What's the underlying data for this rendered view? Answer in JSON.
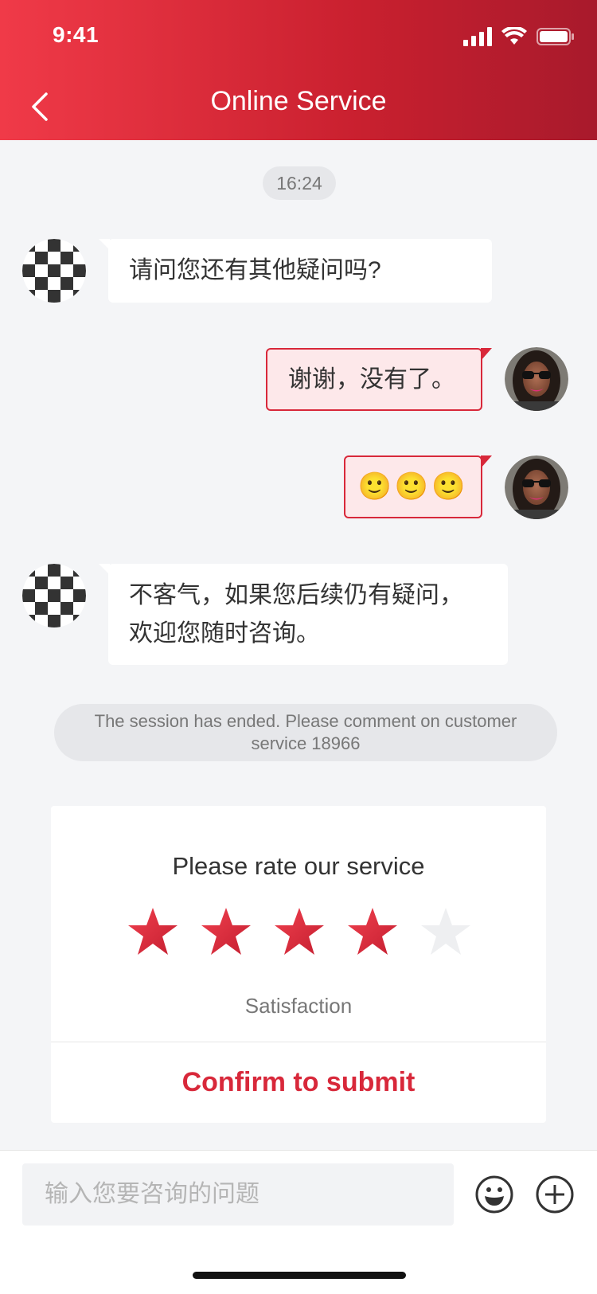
{
  "status_bar": {
    "time": "9:41"
  },
  "header": {
    "title": "Online Service"
  },
  "chat": {
    "timestamp": "16:24",
    "messages": [
      {
        "from": "agent",
        "text": "请问您还有其他疑问吗?"
      },
      {
        "from": "user",
        "text": "谢谢，没有了。"
      },
      {
        "from": "user",
        "text": "🙂🙂🙂"
      },
      {
        "from": "agent",
        "lines": [
          "不客气，如果您后续仍有疑问，",
          "欢迎您随时咨询。"
        ]
      }
    ],
    "session_notice": "The session has ended. Please comment on customer service 18966"
  },
  "rating": {
    "title": "Please rate our service",
    "stars_total": 5,
    "stars_selected": 4,
    "label": "Satisfaction",
    "submit_label": "Confirm to submit"
  },
  "input_bar": {
    "placeholder": "输入您要咨询的问题"
  },
  "colors": {
    "accent": "#d8283a",
    "header_start": "#f03a48",
    "header_end": "#a81a2c",
    "background": "#f4f5f7"
  },
  "icons": [
    "back-chevron",
    "signal",
    "wifi",
    "battery",
    "emoji",
    "plus"
  ]
}
